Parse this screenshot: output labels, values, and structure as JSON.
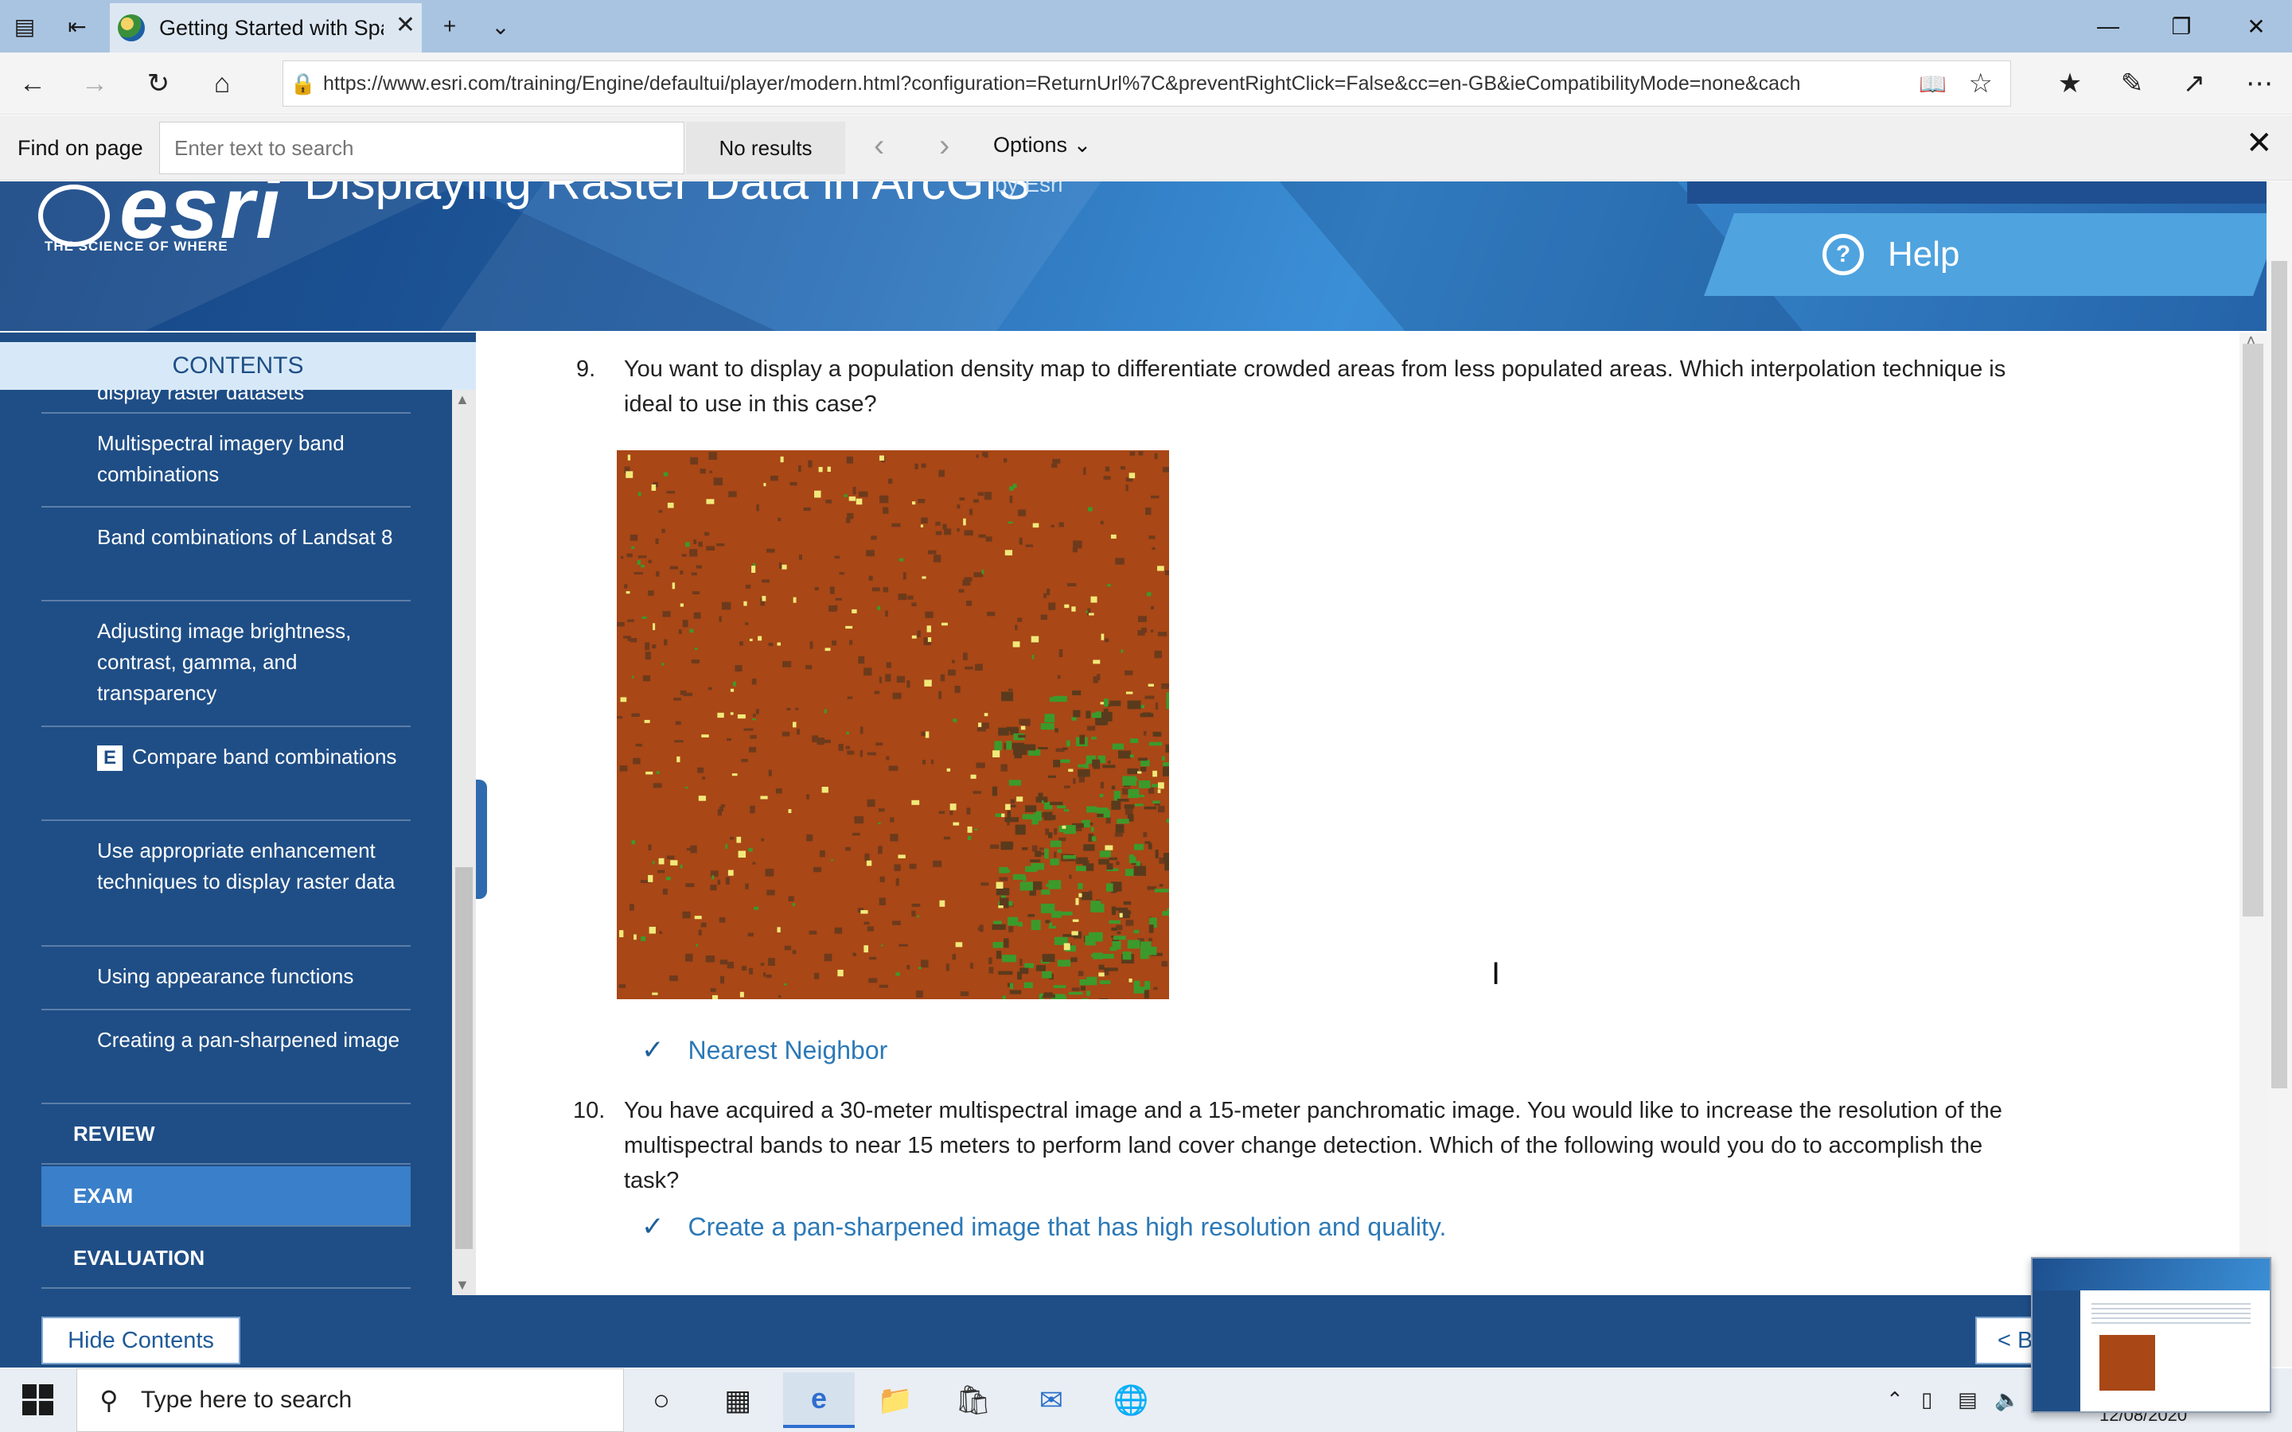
{
  "browser": {
    "tab_title": "Getting Started with Spa",
    "url": "https://www.esri.com/training/Engine/defaultui/player/modern.html?configuration=ReturnUrl%7C&preventRightClick=False&cc=en-GB&ieCompatibilityMode=none&cach",
    "find": {
      "label": "Find on page",
      "placeholder": "Enter text to search",
      "results": "No results",
      "options_label": "Options"
    }
  },
  "course": {
    "logo_text": "esri",
    "tagline": "THE SCIENCE OF WHERE",
    "title": "Displaying Raster Data in ArcGIS",
    "author": "by Esri",
    "help_label": "Help"
  },
  "sidebar": {
    "header": "CONTENTS",
    "items": [
      {
        "label": "display raster datasets"
      },
      {
        "label": "Multispectral imagery band combinations"
      },
      {
        "label": "Band combinations of Landsat 8"
      },
      {
        "label": "Adjusting image brightness, contrast, gamma, and transparency"
      },
      {
        "label": "Compare band combinations",
        "badge": "E"
      },
      {
        "label": "Use appropriate enhancement techniques to display raster data"
      },
      {
        "label": "Using appearance functions"
      },
      {
        "label": "Creating a pan-sharpened image"
      }
    ],
    "sections": [
      {
        "label": "REVIEW",
        "active": false
      },
      {
        "label": "EXAM",
        "active": true
      },
      {
        "label": "EVALUATION",
        "active": false
      }
    ]
  },
  "questions": [
    {
      "number": "9.",
      "line1": "You want to display a population density map to differentiate crowded areas from less populated areas. Which interpolation technique is",
      "line2": "ideal to use in this case?",
      "answer": "Nearest Neighbor"
    },
    {
      "number": "10.",
      "line1": "You have acquired a 30-meter multispectral image and a 15-meter panchromatic image. You would like to increase the resolution of the",
      "line2": "multispectral bands to near 15 meters to perform land cover change detection. Which of the following would you do to accomplish the",
      "line3": "task?",
      "answer": "Create a pan-sharpened image that has high resolution and quality."
    }
  ],
  "footer": {
    "hide_contents": "Hide Contents",
    "back": "< Back"
  },
  "taskbar": {
    "search_placeholder": "Type here to search",
    "date": "12/08/2020"
  },
  "colors": {
    "sidebar_bg": "#1f4e86",
    "active_section": "#3a7fc9",
    "answer_text": "#2c79b7",
    "map_base": "#a94716"
  }
}
